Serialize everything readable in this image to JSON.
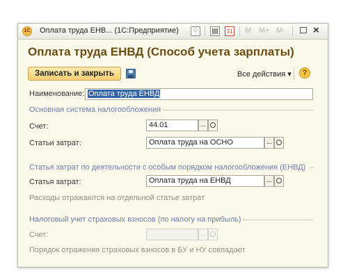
{
  "window": {
    "title": "Оплата труда ЕНВ... (1С:Предприятие)",
    "icon_text": "1С",
    "calendar_text": "31",
    "memory_buttons": [
      "M",
      "M+",
      "M-"
    ],
    "close_glyph": "×"
  },
  "header": {
    "title": "Оплата труда ЕНВД (Способ учета зарплаты)"
  },
  "toolbar": {
    "save_close_label": "Записать и закрыть",
    "all_actions_label": "Все действия ▾",
    "help_glyph": "?"
  },
  "form": {
    "name_label": "Наименование:",
    "name_value": "Оплата труда ЕНВД",
    "main_tax": {
      "title": "Основная система налогообложения",
      "account_label": "Счет:",
      "account_value": "44.01",
      "cost_label": "Статьи затрат:",
      "cost_value": "Оплата труда на ОСНО"
    },
    "special_tax": {
      "title": "Статья затрат по деятельности с особым порядком налогообложения (ЕНВД)",
      "cost_label": "Статья затрат:",
      "cost_value": "Оплата труда на ЕНВД",
      "note": "Расходы отражаются на отдельной статье затрат"
    },
    "insurance": {
      "title": "Налоговый учет страховых взносов (по налогу на прибыль)",
      "account_label": "Счет:",
      "account_value": "",
      "note": "Порядок отражения страховых взносов в БУ и НУ совпадает"
    },
    "picker_glyph": "..."
  },
  "colors": {
    "accent_title": "#6b4c13",
    "group_title": "#6b7bb0",
    "button_fill": "#f1cf73",
    "selection": "#3264a8"
  },
  "icons": [
    "app-1c-icon",
    "favorite-icon",
    "calculator-icon",
    "calendar-icon",
    "save-icon",
    "help-icon",
    "search-icon"
  ]
}
